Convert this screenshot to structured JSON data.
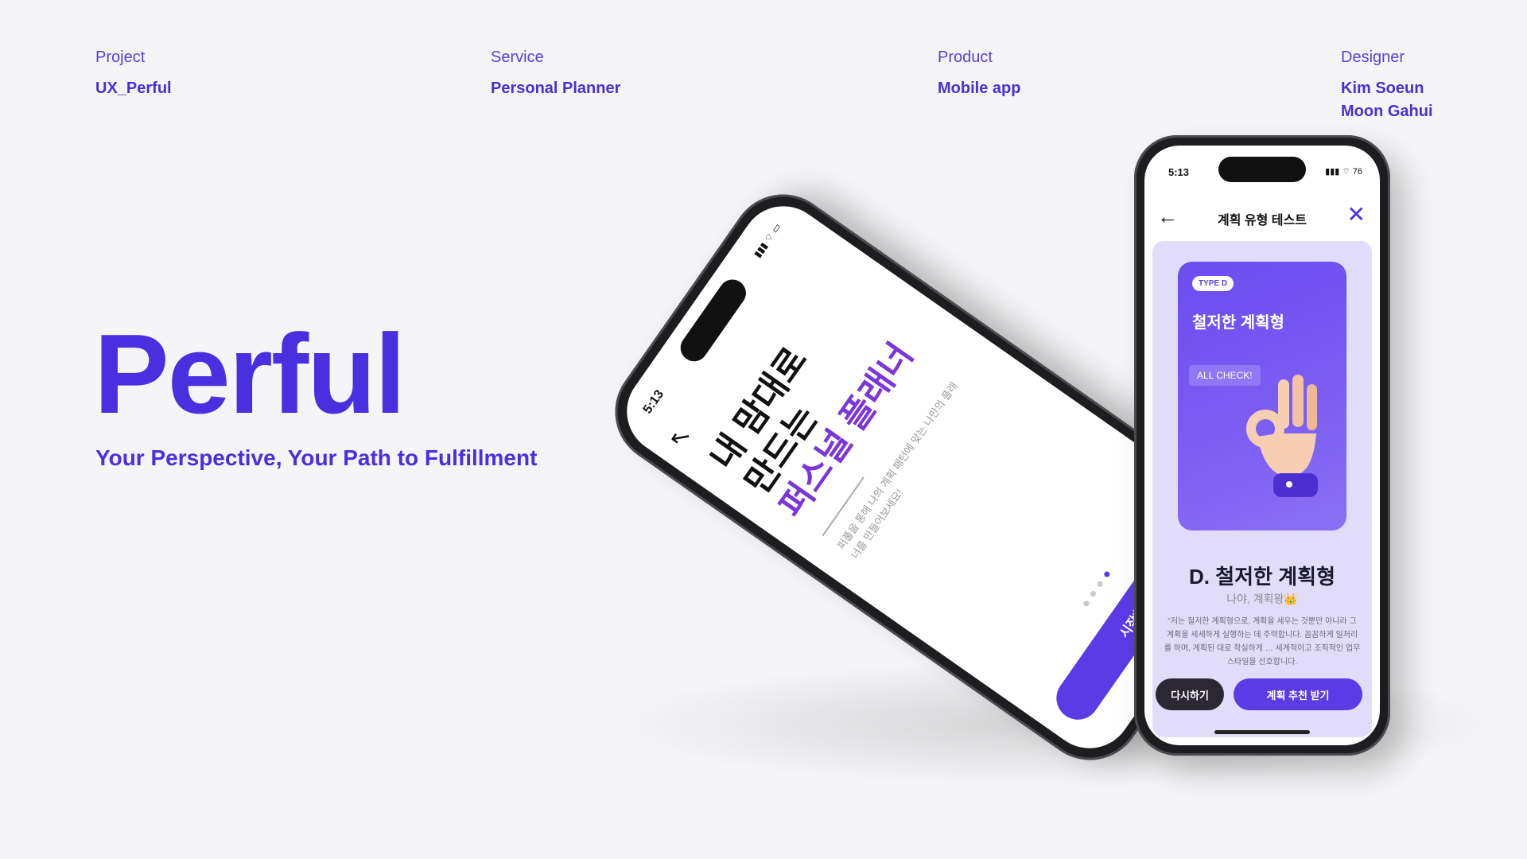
{
  "meta": [
    {
      "label": "Project",
      "value": "UX_Perful",
      "value2": ""
    },
    {
      "label": "Service",
      "value": "Personal Planner",
      "value2": ""
    },
    {
      "label": "Product",
      "value": "Mobile app",
      "value2": ""
    },
    {
      "label": "Designer",
      "value": "Kim Soeun",
      "value2": "Moon Gahui"
    }
  ],
  "brand": {
    "name": "Perful",
    "tagline": "Your Perspective, Your Path to Fulfillment"
  },
  "phone_intro": {
    "time": "5:13",
    "status": "▮▮▮ ⌔ ▭",
    "back_icon": "↖",
    "title_line1": "내 맘대로",
    "title_line2": "만드는",
    "title_accent": "퍼스널 플래너",
    "subtitle": "퍼풀을 통해 나의 계획 패턴에 맞는 나만의 플래너를 만들어보세요!",
    "dots": [
      false,
      false,
      false,
      true
    ],
    "start_label": "시작하기"
  },
  "phone_result": {
    "time": "5:13",
    "status": "▮▮▮ ⌔ 76",
    "back_icon": "←",
    "title": "계획 유형 테스트",
    "close_icon": "✕",
    "badge": "TYPE D",
    "card_title": "철저한 계획형",
    "bubble": "ALL CHECK!",
    "type_title": "D. 철저한 계획형",
    "type_sub": "나야, 계획왕👑",
    "description": "\"저는 철저한 계획형으로, 계획을 세우는 것뿐만 아니라 그 계획을 세세하게 실행하는 데 주력합니다. 꼼꼼하게 일처리를 하며, 계획된 대로 착실하게 … 세계적이고 조직적인 업무 스타일을 선호합니다.",
    "retry_label": "다시하기",
    "recommend_label": "계획 추천 받기"
  },
  "colors": {
    "accent": "#4a2fe0",
    "button": "#5b3be6",
    "background": "#f5f5f7"
  }
}
